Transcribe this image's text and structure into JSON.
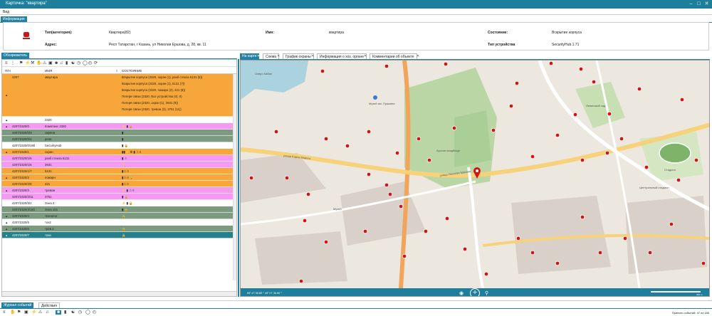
{
  "window": {
    "title": "Карточка: \"квартира\"",
    "minimize": "–",
    "maximize": "□",
    "close": "✕"
  },
  "menu": {
    "view": "Вид"
  },
  "info_tab": "Информация",
  "info": {
    "type_label": "Тип(категория):",
    "type_value": "Квартира(82)",
    "name_label": "Имя:",
    "name_value": "квартира",
    "state_label": "Состояние:",
    "state_value": "Вскрытие корпуса",
    "address_label": "Адрес:",
    "address_value": "Респ Татарстан, г Казань, ул Николая Ершова, д. 28, кв. 11",
    "device_label": "Тип устройства",
    "device_value": "SecurityHub.1.71"
  },
  "left_tab": "Обозреватель",
  "tree_header": {
    "col1": "П/Н",
    "col2": "ИМЯ",
    "col3": "СОСТОЯНИЕ"
  },
  "tree_rows": [
    {
      "id": "4207",
      "name": "квартира",
      "color": "orange",
      "states": [
        "Вскрытие корпуса (2320, охран (1), разб стекла 6131 (5))",
        "Вскрытие корпуса (2320, охран (1), 5131 (7))",
        "Вскрытие корпуса (2320, пожарн (2), 421 (8))",
        "Потеря связи (2320, Все устройства (0), 0)",
        "Потеря связи (2320, охран (1), 3931 (9))",
        "Потеря связи (2320, тревож (3), 3751 (11))"
      ]
    },
    {
      "id": "",
      "name": "2320",
      "color": "white",
      "states": [
        ""
      ]
    },
    {
      "id": "4207/2320/0",
      "name": "Комплекс 2320",
      "color": "pink",
      "states": [
        "⚡ ▮ 🔒"
      ]
    },
    {
      "id": "4207/2320/0/3",
      "name": "сирена",
      "color": "green",
      "states": [
        "▮"
      ]
    },
    {
      "id": "4207/2320/0/4",
      "name": "реле",
      "color": "green",
      "states": [
        "▮"
      ]
    },
    {
      "id": "4207/2320/0/180",
      "name": "SecurityHub",
      "color": "white",
      "states": [
        "▮ 🔒"
      ]
    },
    {
      "id": "4207/2320/1",
      "name": "охран",
      "color": "orange",
      "states": [
        "▮▮ ⚡⚙ ▮ ☃ ¤"
      ]
    },
    {
      "id": "4207/2320/1/5",
      "name": "разб стекла 6131",
      "color": "pink",
      "states": [
        "▮ ☃"
      ]
    },
    {
      "id": "4207/2320/1/6",
      "name": "3931",
      "color": "pink",
      "states": [
        "⚡"
      ]
    },
    {
      "id": "4207/2320/1/7",
      "name": "5131",
      "color": "orange",
      "states": [
        "▮☃ ¤"
      ]
    },
    {
      "id": "4207/2320/2",
      "name": "пожарн",
      "color": "orange",
      "states": [
        "▮☃ ¤ 🔒"
      ]
    },
    {
      "id": "4207/2320/2/8",
      "name": "421",
      "color": "orange",
      "states": [
        "▮☃ ¤"
      ]
    },
    {
      "id": "4207/2320/3",
      "name": "тревож",
      "color": "pink",
      "states": [
        "⚡ ▮ ☃ ¤"
      ]
    },
    {
      "id": "4207/2320/3/11",
      "name": "3751",
      "color": "pink",
      "states": [
        "▮ 🔒"
      ]
    },
    {
      "id": "4207/2320/3/2",
      "name": "Зона 2",
      "color": "white",
      "states": [
        "⚡ ▮ 🔒"
      ]
    },
    {
      "id": "4207/2320/3/181",
      "name": "Зона 101",
      "color": "green",
      "states": [
        "▮ 🔒"
      ]
    },
    {
      "id": "4207/2320/4",
      "name": "технолог",
      "color": "green",
      "states": [
        "🔒"
      ]
    },
    {
      "id": "4207/2320/5",
      "name": "тох2",
      "color": "white",
      "states": [
        ""
      ]
    },
    {
      "id": "4207/2320/6",
      "name": "трев 2",
      "color": "green",
      "states": [
        "🔒"
      ]
    },
    {
      "id": "4207/2320/7",
      "name": "тохи",
      "color": "teal",
      "states": [
        "🔒"
      ]
    }
  ],
  "map_tabs": [
    "На карте",
    "Схема",
    "График охраны",
    "Информация о хоз. органе",
    "Комментарии об объекте"
  ],
  "map": {
    "coords": "55° 47' 55.68\" ° 49° 07' 36.96\" °",
    "scale": "300 m",
    "labels": {
      "park": "Арское кладбище",
      "street1": "улица Николая Ершова",
      "street2": "улица Карла Маркса",
      "kremlin": "Ленинский сад",
      "stadium": "Стадион",
      "lake": "Озеро Кабан",
      "museum": "Музей",
      "sports": "Центральный стадион"
    },
    "blue_poi": "Музей им. Пушкина"
  },
  "bottom_tabs": [
    "Журнал событий",
    "Действия"
  ],
  "status_right": "Принято событий: 47 из 186",
  "colors": {
    "accent": "#1e7f9c",
    "orange": "#f7a73a",
    "pink": "#f59af2",
    "green": "#7c9a80",
    "teal": "#26808a"
  }
}
